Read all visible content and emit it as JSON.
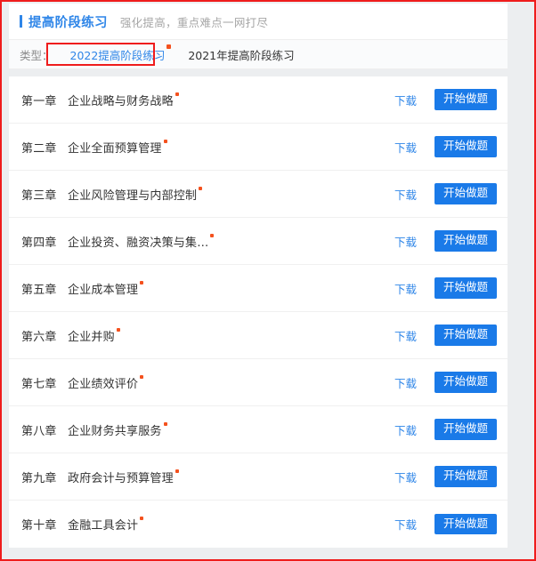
{
  "header": {
    "title": "提高阶段练习",
    "subtitle": "强化提高，重点难点一网打尽",
    "accent_color": "#2f86e8"
  },
  "filter": {
    "label": "类型：",
    "tabs": [
      {
        "label": "2022提高阶段练习",
        "active": true,
        "dot": true
      },
      {
        "label": "2021年提高阶段练习",
        "active": false,
        "dot": false
      }
    ],
    "highlight_color": "#ef1c1c",
    "dot_color": "#f4511e"
  },
  "list": {
    "download_label": "下载",
    "start_label": "开始做题",
    "button_color": "#1a7ae8",
    "rows": [
      {
        "no": "第一章",
        "name": "企业战略与财务战略",
        "dot": true
      },
      {
        "no": "第二章",
        "name": "企业全面预算管理",
        "dot": true
      },
      {
        "no": "第三章",
        "name": "企业风险管理与内部控制",
        "dot": true
      },
      {
        "no": "第四章",
        "name": "企业投资、融资决策与集…",
        "dot": true
      },
      {
        "no": "第五章",
        "name": "企业成本管理",
        "dot": true
      },
      {
        "no": "第六章",
        "name": "企业并购",
        "dot": true
      },
      {
        "no": "第七章",
        "name": "企业绩效评价",
        "dot": true
      },
      {
        "no": "第八章",
        "name": "企业财务共享服务",
        "dot": true
      },
      {
        "no": "第九章",
        "name": "政府会计与预算管理",
        "dot": true
      },
      {
        "no": "第十章",
        "name": "金融工具会计",
        "dot": true
      }
    ]
  }
}
